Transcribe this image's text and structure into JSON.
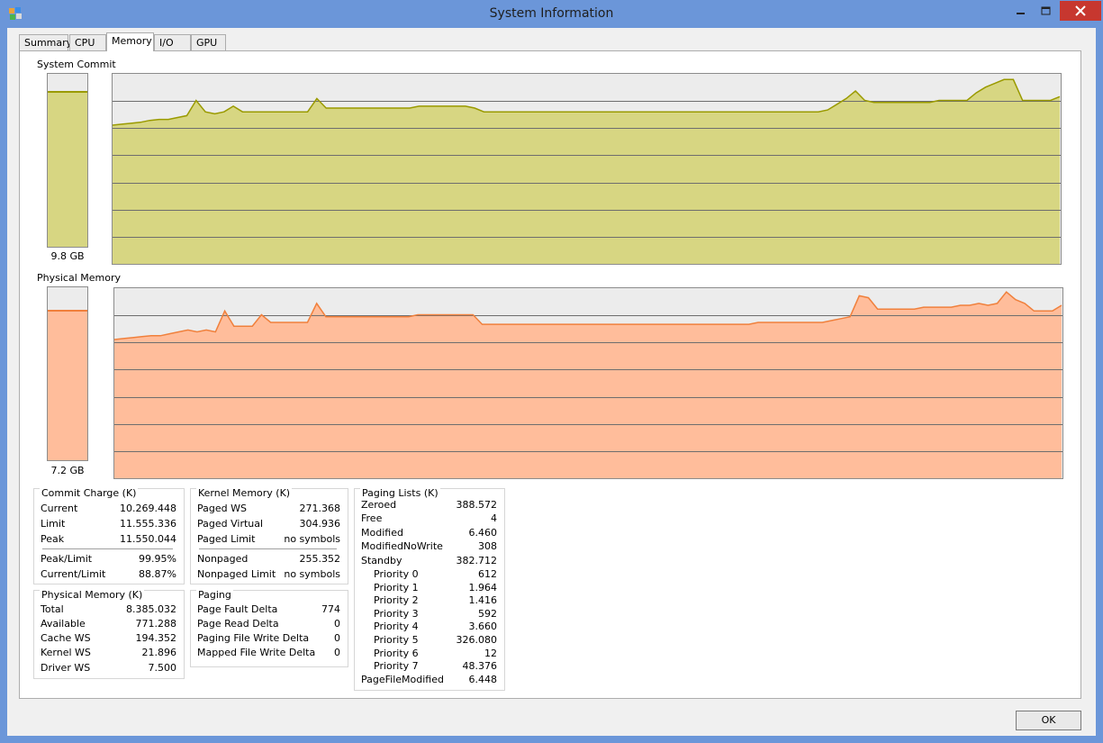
{
  "window": {
    "title": "System Information"
  },
  "tabs": [
    "Summary",
    "CPU",
    "Memory",
    "I/O",
    "GPU"
  ],
  "active_tab": "Memory",
  "graphs": {
    "commit": {
      "label": "System Commit",
      "value": "9.8 GB",
      "bar_fraction": 0.89,
      "fill": "#d7d682",
      "line": "#9a9a00",
      "series": [
        0.73,
        0.735,
        0.74,
        0.745,
        0.755,
        0.76,
        0.76,
        0.77,
        0.78,
        0.86,
        0.8,
        0.79,
        0.8,
        0.83,
        0.8,
        0.8,
        0.8,
        0.8,
        0.8,
        0.8,
        0.8,
        0.8,
        0.87,
        0.82,
        0.82,
        0.82,
        0.82,
        0.82,
        0.82,
        0.82,
        0.82,
        0.82,
        0.82,
        0.83,
        0.83,
        0.83,
        0.83,
        0.83,
        0.83,
        0.82,
        0.8,
        0.8,
        0.8,
        0.8,
        0.8,
        0.8,
        0.8,
        0.8,
        0.8,
        0.8,
        0.8,
        0.8,
        0.8,
        0.8,
        0.8,
        0.8,
        0.8,
        0.8,
        0.8,
        0.8,
        0.8,
        0.8,
        0.8,
        0.8,
        0.8,
        0.8,
        0.8,
        0.8,
        0.8,
        0.8,
        0.8,
        0.8,
        0.8,
        0.8,
        0.8,
        0.8,
        0.8,
        0.81,
        0.84,
        0.87,
        0.91,
        0.86,
        0.85,
        0.85,
        0.85,
        0.85,
        0.85,
        0.85,
        0.85,
        0.86,
        0.86,
        0.86,
        0.86,
        0.9,
        0.93,
        0.95,
        0.97,
        0.97,
        0.86,
        0.86,
        0.86,
        0.86,
        0.88
      ]
    },
    "physical": {
      "label": "Physical Memory",
      "value": "7.2 GB",
      "bar_fraction": 0.86,
      "fill": "#ffbd9b",
      "line": "#f0803c",
      "series": [
        0.73,
        0.735,
        0.74,
        0.745,
        0.75,
        0.75,
        0.76,
        0.77,
        0.78,
        0.77,
        0.78,
        0.77,
        0.88,
        0.8,
        0.8,
        0.8,
        0.86,
        0.82,
        0.82,
        0.82,
        0.82,
        0.82,
        0.92,
        0.85,
        0.85,
        0.85,
        0.85,
        0.85,
        0.85,
        0.85,
        0.85,
        0.85,
        0.85,
        0.86,
        0.86,
        0.86,
        0.86,
        0.86,
        0.86,
        0.86,
        0.81,
        0.81,
        0.81,
        0.81,
        0.81,
        0.81,
        0.81,
        0.81,
        0.81,
        0.81,
        0.81,
        0.81,
        0.81,
        0.81,
        0.81,
        0.81,
        0.81,
        0.81,
        0.81,
        0.81,
        0.81,
        0.81,
        0.81,
        0.81,
        0.81,
        0.81,
        0.81,
        0.81,
        0.81,
        0.81,
        0.82,
        0.82,
        0.82,
        0.82,
        0.82,
        0.82,
        0.82,
        0.82,
        0.83,
        0.84,
        0.85,
        0.96,
        0.95,
        0.89,
        0.89,
        0.89,
        0.89,
        0.89,
        0.9,
        0.9,
        0.9,
        0.9,
        0.91,
        0.91,
        0.92,
        0.91,
        0.92,
        0.98,
        0.94,
        0.92,
        0.88,
        0.88,
        0.88,
        0.91
      ]
    }
  },
  "commit_charge": {
    "title": "Commit Charge (K)",
    "rows": [
      {
        "label": "Current",
        "value": "10.269.448"
      },
      {
        "label": "Limit",
        "value": "11.555.336"
      },
      {
        "label": "Peak",
        "value": "11.550.044"
      }
    ],
    "rows2": [
      {
        "label": "Peak/Limit",
        "value": "99.95%"
      },
      {
        "label": "Current/Limit",
        "value": "88.87%"
      }
    ]
  },
  "physical_memory": {
    "title": "Physical Memory (K)",
    "rows": [
      {
        "label": "Total",
        "value": "8.385.032"
      },
      {
        "label": "Available",
        "value": "771.288"
      },
      {
        "label": "Cache WS",
        "value": "194.352"
      },
      {
        "label": "Kernel WS",
        "value": "21.896"
      },
      {
        "label": "Driver WS",
        "value": "7.500"
      }
    ]
  },
  "kernel_memory": {
    "title": "Kernel Memory (K)",
    "rows": [
      {
        "label": "Paged WS",
        "value": "271.368"
      },
      {
        "label": "Paged Virtual",
        "value": "304.936"
      },
      {
        "label": "Paged Limit",
        "value": "no symbols"
      }
    ],
    "rows2": [
      {
        "label": "Nonpaged",
        "value": "255.352"
      },
      {
        "label": "Nonpaged Limit",
        "value": "no symbols"
      }
    ]
  },
  "paging": {
    "title": "Paging",
    "rows": [
      {
        "label": "Page Fault Delta",
        "value": "774"
      },
      {
        "label": "Page Read Delta",
        "value": "0"
      },
      {
        "label": "Paging File Write Delta",
        "value": "0"
      },
      {
        "label": "Mapped File Write Delta",
        "value": "0"
      }
    ]
  },
  "paging_lists": {
    "title": "Paging Lists (K)",
    "rows": [
      {
        "label": "Zeroed",
        "value": "388.572"
      },
      {
        "label": "Free",
        "value": "4"
      },
      {
        "label": "Modified",
        "value": "6.460"
      },
      {
        "label": "ModifiedNoWrite",
        "value": "308"
      },
      {
        "label": "Standby",
        "value": "382.712"
      }
    ],
    "priorities": [
      {
        "label": "Priority 0",
        "value": "612"
      },
      {
        "label": "Priority 1",
        "value": "1.964"
      },
      {
        "label": "Priority 2",
        "value": "1.416"
      },
      {
        "label": "Priority 3",
        "value": "592"
      },
      {
        "label": "Priority 4",
        "value": "3.660"
      },
      {
        "label": "Priority 5",
        "value": "326.080"
      },
      {
        "label": "Priority 6",
        "value": "12"
      },
      {
        "label": "Priority 7",
        "value": "48.376"
      }
    ],
    "last": {
      "label": "PageFileModified",
      "value": "6.448"
    }
  },
  "buttons": {
    "ok": "OK"
  }
}
